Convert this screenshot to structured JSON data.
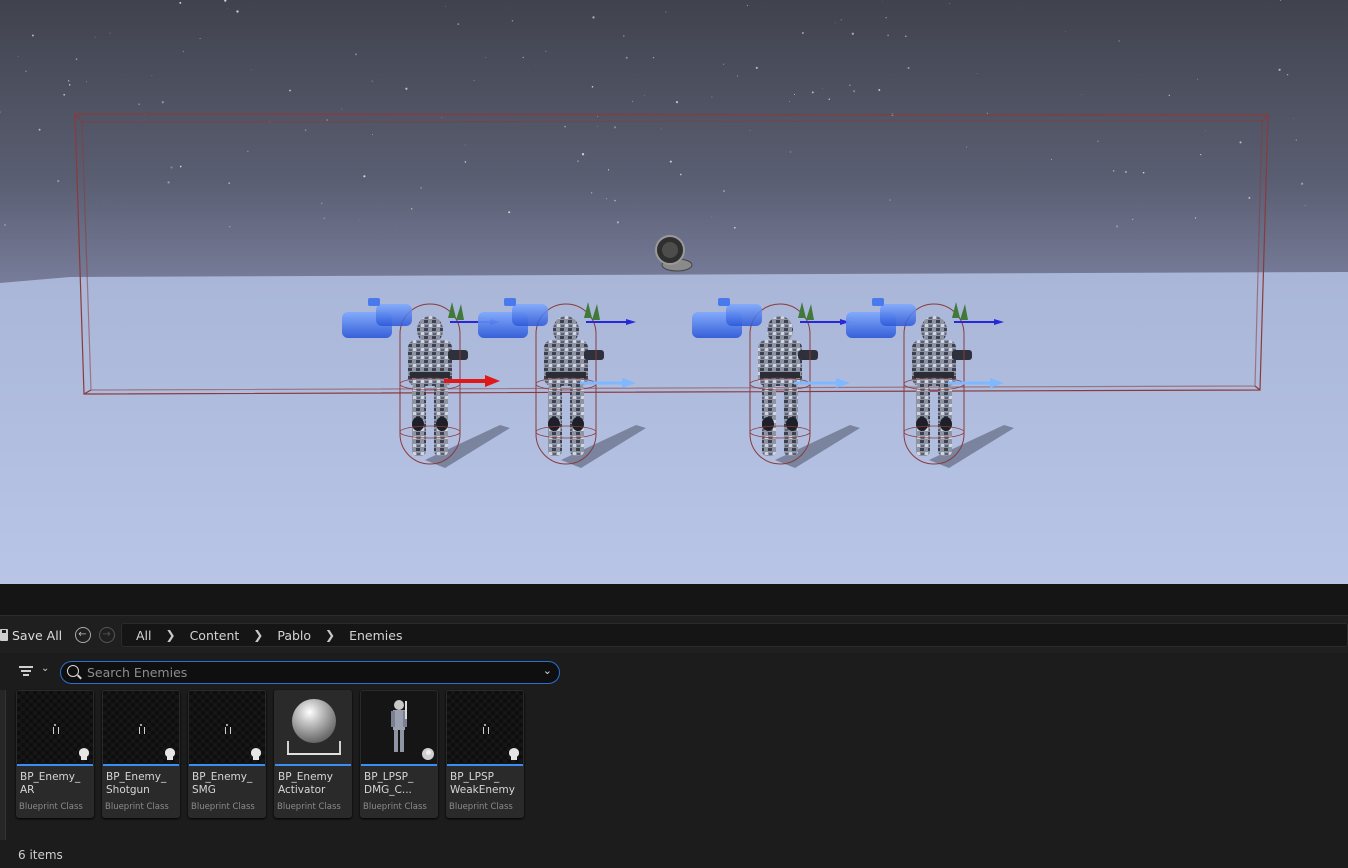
{
  "toolbar": {
    "save_all_label": "Save All",
    "back_icon": "arrow-left-circle-icon",
    "forward_icon": "arrow-right-circle-icon"
  },
  "breadcrumb": [
    "All",
    "Content",
    "Pablo",
    "Enemies"
  ],
  "search": {
    "placeholder": "Search Enemies",
    "value": ""
  },
  "assets": [
    {
      "name": "BP_Enemy_\nAR",
      "type": "Blueprint Class",
      "icon": "skull-icon"
    },
    {
      "name": "BP_Enemy_\nShotgun",
      "type": "Blueprint Class",
      "icon": "skull-icon"
    },
    {
      "name": "BP_Enemy_\nSMG",
      "type": "Blueprint Class",
      "icon": "skull-icon"
    },
    {
      "name": "BP_Enemy\nActivator",
      "type": "Blueprint Class",
      "icon": "sphere-icon"
    },
    {
      "name": "BP_LPSP_\nDMG_C...",
      "type": "Blueprint Class",
      "icon": "disc-icon"
    },
    {
      "name": "BP_LPSP_\nWeakEnemy",
      "type": "Blueprint Class",
      "icon": "skull-icon"
    }
  ],
  "status": {
    "item_count": "6 items"
  },
  "colors": {
    "accent": "#3b8ef0",
    "search_border": "#2b6fd1",
    "selection_box": "#8a3a3a",
    "x_axis": "#e01818",
    "y_axis": "#2828d8"
  }
}
